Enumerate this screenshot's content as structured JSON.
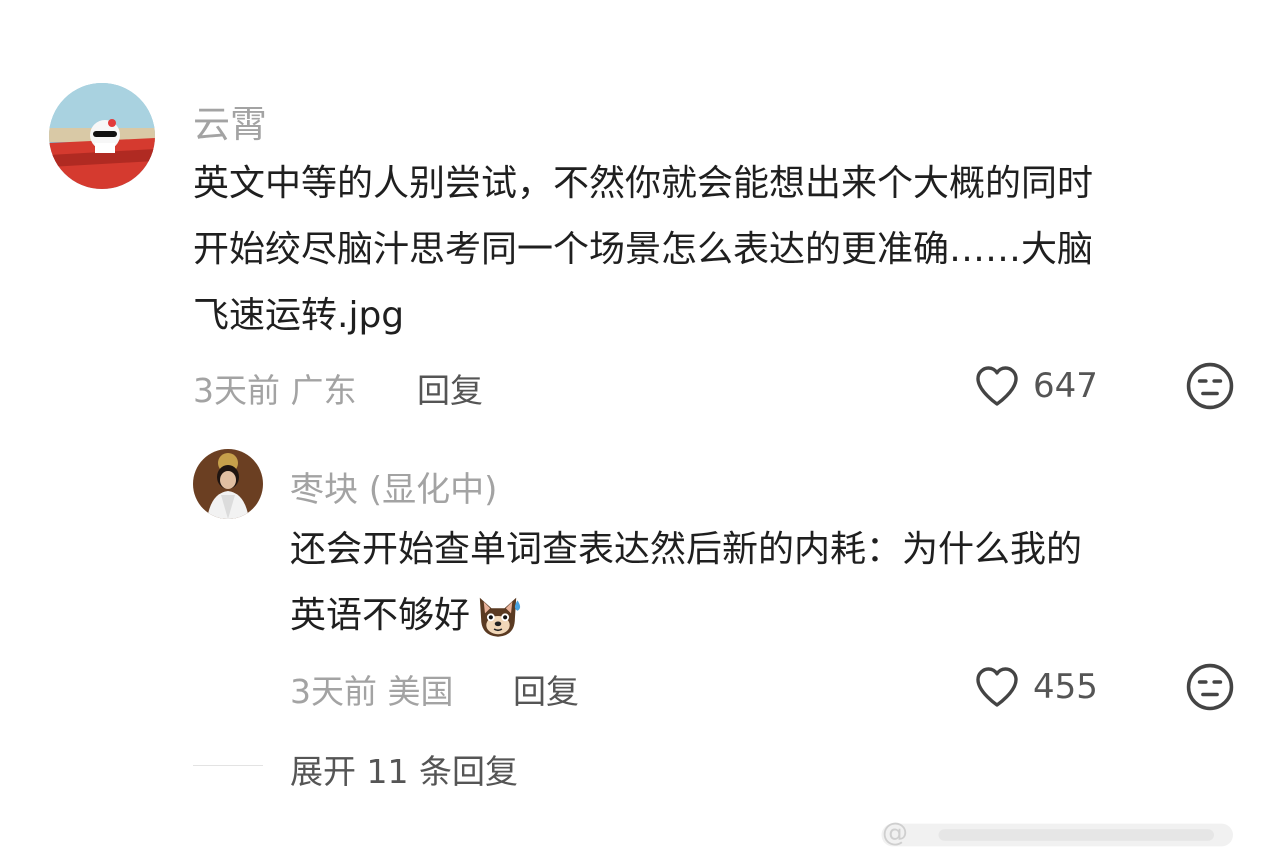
{
  "comment": {
    "username": "云霄",
    "lines": [
      "英文中等的人别尝试，不然你就会能想出来个大概的同时",
      "开始绞尽脑汁思考同一个场景怎么表达的更准确……大脑",
      "飞速运转.jpg"
    ],
    "meta": "3天前 广东",
    "reply_label": "回复",
    "like_count": "647"
  },
  "reply": {
    "username": "枣块 (显化中)",
    "lines": [
      "还会开始查单词查表达然后新的内耗：为什么我的",
      "英语不够好"
    ],
    "emoji": "dog-sweat-emoji",
    "meta": "3天前 美国",
    "reply_label": "回复",
    "like_count": "455"
  },
  "expand_label": "展开 11 条回复",
  "watermark_text": "@",
  "colors": {
    "secondary_text": "#a3a3a3",
    "primary_text": "#1f1f1f",
    "icon": "#444444"
  }
}
